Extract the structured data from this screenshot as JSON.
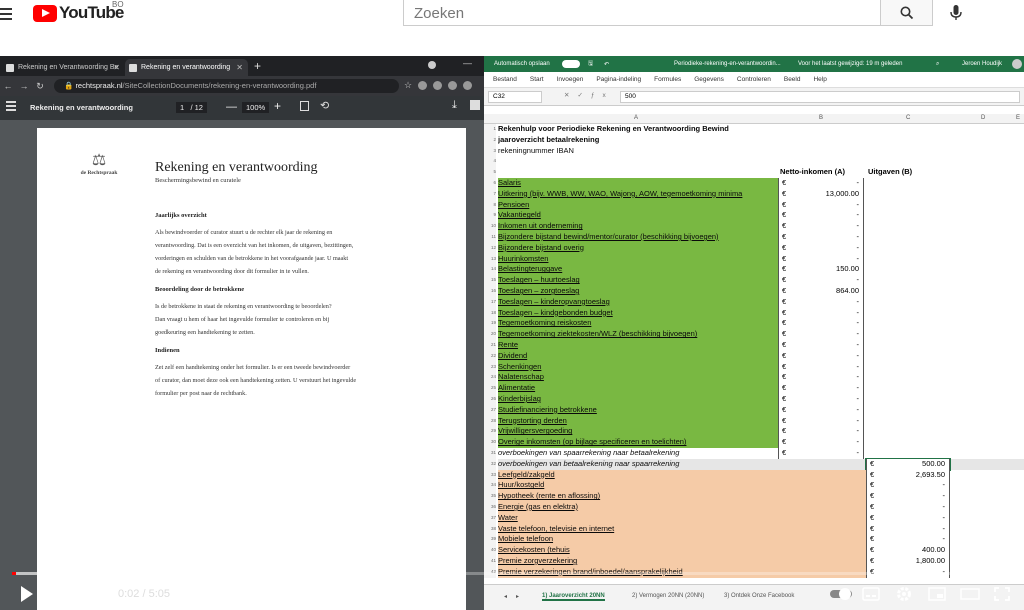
{
  "youtube": {
    "logo_text": "YouTube",
    "country": "BO",
    "search_placeholder": "Zoeken"
  },
  "chrome": {
    "tabs": [
      {
        "title": "Rekening en Verantwoording Be"
      },
      {
        "title": "Rekening en verantwoording"
      }
    ],
    "url_domain": "rechtspraak.nl",
    "url_path": "/SiteCollectionDocuments/rekening-en-verantwoording.pdf"
  },
  "pdf": {
    "title": "Rekening en verantwoording",
    "page_current": "1",
    "page_total": "/ 12",
    "zoom": "100%",
    "logo_label": "de Rechtspraak",
    "doc_title": "Rekening en verantwoording",
    "doc_subtitle": "Beschermingsbewind en curatele",
    "sections": [
      {
        "heading": "Jaarlijks overzicht",
        "lines": [
          "Als bewindvoerder of curator stuurt u de rechter elk jaar de rekening en",
          "verantwoording. Dat is een overzicht van het inkomen, de uitgaven, bezittingen,",
          "vorderingen en schulden van de betrokkene in het voorafgaande jaar. U maakt",
          "de rekening en verantwoording door dit formulier in te vullen."
        ]
      },
      {
        "heading": "Beoordeling door de betrokkene",
        "lines": [
          "Is de betrokkene in staat de rekening en verantwoording te beoordelen?",
          "Dan vraagt u hem of haar het ingevulde formulier te controleren en bij",
          "goedkeuring een handtekening te zetten."
        ]
      },
      {
        "heading": "Indienen",
        "lines": [
          "Zet zelf een handtekening onder het formulier. Is er een tweede bewindvoerder",
          "of curator, dan moet deze ook een handtekening zetten. U verstuurt het ingevulde",
          "formulier per post naar de rechtbank."
        ]
      }
    ]
  },
  "excel": {
    "autosave": "Automatisch opslaan",
    "file": "Periodieke-rekening-en-verantwoordin...",
    "saved": "Voor het laatst gewijzigd: 19 m geleden",
    "user": "Jeroen Houdijk",
    "ribbon": [
      "Bestand",
      "Start",
      "Invoegen",
      "Pagina-indeling",
      "Formules",
      "Gegevens",
      "Controleren",
      "Beeld",
      "Help"
    ],
    "name_box": "C32",
    "formula_value": "500",
    "columns": [
      "A",
      "B",
      "C",
      "D",
      "E"
    ],
    "header_rows": [
      {
        "n": "1",
        "text": "Rekenhulp voor Periodieke Rekening en Verantwoording Bewind",
        "bold": true
      },
      {
        "n": "2",
        "text": "jaaroverzicht betaalrekening",
        "bold": true
      },
      {
        "n": "3",
        "text": "rekeningnummer IBAN",
        "bold": false
      },
      {
        "n": "4",
        "text": "",
        "bold": false
      },
      {
        "n": "5",
        "text": "",
        "bold": false,
        "colb": "Netto-inkomen (A)",
        "colc": "Uitgaven (B)"
      }
    ],
    "income_rows": [
      {
        "n": "6",
        "label": "Salaris",
        "b": "-"
      },
      {
        "n": "7",
        "label": "Uitkering (bijv. WWB, WW, WAO, Wajong, AOW, tegemoetkoming minima",
        "b": "13,000.00"
      },
      {
        "n": "8",
        "label": "Pensioen",
        "b": "-"
      },
      {
        "n": "9",
        "label": "Vakantiegeld",
        "b": "-"
      },
      {
        "n": "10",
        "label": "Inkomen uit onderneming",
        "b": "-"
      },
      {
        "n": "11",
        "label": "Bijzondere bijstand bewind/mentor/curator (beschikking bijvoegen)",
        "b": "-"
      },
      {
        "n": "12",
        "label": "Bijzondere bijstand overig",
        "b": "-"
      },
      {
        "n": "13",
        "label": "Huurinkomsten",
        "b": "-"
      },
      {
        "n": "14",
        "label": "Belastingteruggave",
        "b": "150.00"
      },
      {
        "n": "15",
        "label": "Toeslagen – huurtoeslag",
        "b": "-"
      },
      {
        "n": "16",
        "label": "Toeslagen – zorgtoeslag",
        "b": "864.00"
      },
      {
        "n": "17",
        "label": "Toeslagen – kinderopvangtoeslag",
        "b": "-"
      },
      {
        "n": "18",
        "label": "Toeslagen – kindgebonden budget",
        "b": "-"
      },
      {
        "n": "19",
        "label": "Tegemoetkoming reiskosten",
        "b": "-"
      },
      {
        "n": "20",
        "label": "Tegemoetkoming ziektekosten/WLZ (beschikking bijvoegen)",
        "b": "-"
      },
      {
        "n": "21",
        "label": "Rente",
        "b": "-"
      },
      {
        "n": "22",
        "label": "Dividend",
        "b": "-"
      },
      {
        "n": "23",
        "label": "Schenkingen",
        "b": "-"
      },
      {
        "n": "24",
        "label": "Nalatenschap",
        "b": "-"
      },
      {
        "n": "25",
        "label": "Alimentatie",
        "b": "-"
      },
      {
        "n": "26",
        "label": "Kinderbijslag",
        "b": "-"
      },
      {
        "n": "27",
        "label": "Studiefinanciering betrokkene",
        "b": "-"
      },
      {
        "n": "28",
        "label": "Terugstorting derden",
        "b": "-"
      },
      {
        "n": "29",
        "label": "Vrijwilligersvergoeding",
        "b": "-"
      },
      {
        "n": "30",
        "label": "Overige inkomsten (op bijlage specificeren en toelichten)",
        "b": "-"
      }
    ],
    "transfer_rows": [
      {
        "n": "31",
        "label": "overboekingen van spaarrekening naar betaalrekening",
        "b": "-"
      },
      {
        "n": "32",
        "label": "overboekingen van betaalrekening naar spaarrekening",
        "c": "500.00"
      }
    ],
    "expense_rows": [
      {
        "n": "33",
        "label": "Leefgeld/zakgeld",
        "c": "2,693.50"
      },
      {
        "n": "34",
        "label": "Huur/kostgeld",
        "c": "-"
      },
      {
        "n": "35",
        "label": "Hypotheek (rente en aflossing)",
        "c": "-"
      },
      {
        "n": "36",
        "label": "Energie (gas en elektra)",
        "c": "-"
      },
      {
        "n": "37",
        "label": "Water",
        "c": "-"
      },
      {
        "n": "38",
        "label": "Vaste telefoon, televisie en internet",
        "c": "-"
      },
      {
        "n": "39",
        "label": "Mobiele telefoon",
        "c": "-"
      },
      {
        "n": "40",
        "label": "Servicekosten (tehuis",
        "c": "400.00"
      },
      {
        "n": "41",
        "label": "Premie zorgverzekering",
        "c": "1,800.00"
      },
      {
        "n": "42",
        "label": "Premie verzekeringen brand/inboedel/aansprakelijkheid",
        "c": "-"
      }
    ],
    "sheet_tabs": [
      "1) Jaaroverzicht 20NN",
      "2) Vermogen 20NN (20NN)",
      "3) Ontdek Onze Facebook"
    ]
  },
  "player": {
    "time": "0:02 / 5:05",
    "progress": 0.004,
    "buffered": 0.4
  },
  "colors": {
    "green": "#79b842",
    "orange": "#f5cba7",
    "yt_red": "#ff0000",
    "excel_green": "#217346"
  }
}
